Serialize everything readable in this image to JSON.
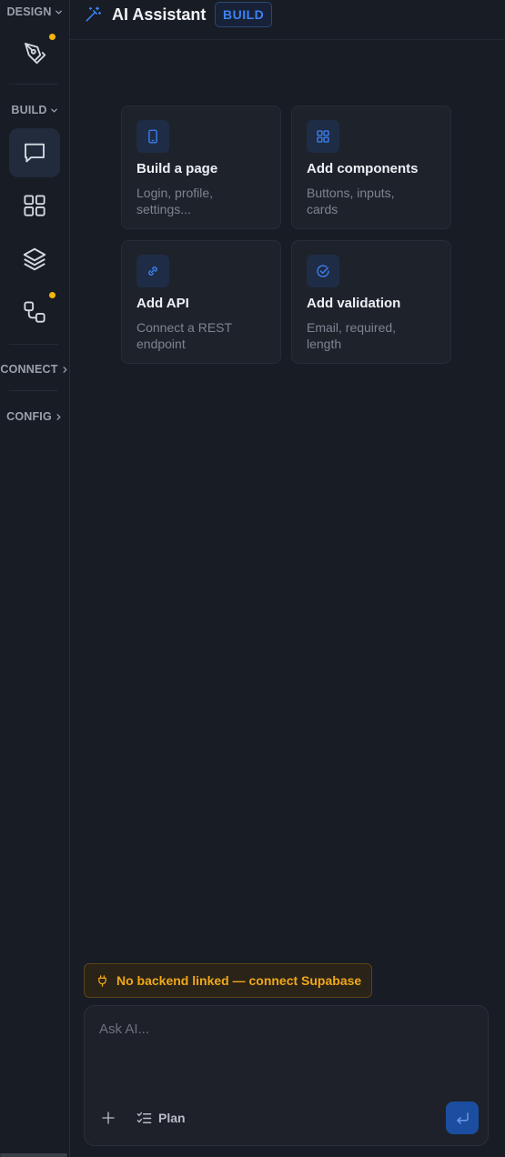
{
  "rail": {
    "design_label": "DESIGN",
    "build_label": "BUILD",
    "connect_label": "CONNECT",
    "config_label": "CONFIG",
    "items": [
      {
        "icon": "pen-tool-icon",
        "has_dot": true
      },
      {
        "icon": "chat-icon",
        "active": true
      },
      {
        "icon": "grid-icon"
      },
      {
        "icon": "layers-icon"
      },
      {
        "icon": "workflow-icon",
        "has_dot": true
      }
    ]
  },
  "header": {
    "icon": "magic-wand-icon",
    "title": "AI Assistant",
    "badge": "BUILD"
  },
  "cards": [
    {
      "icon": "phone-icon",
      "title": "Build a page",
      "desc": "Login, profile, settings..."
    },
    {
      "icon": "grid-icon",
      "title": "Add components",
      "desc": "Buttons, inputs, cards"
    },
    {
      "icon": "link-icon",
      "title": "Add API",
      "desc": "Connect a REST endpoint"
    },
    {
      "icon": "check-circle-icon",
      "title": "Add validation",
      "desc": "Email, required, length"
    }
  ],
  "notice": {
    "icon": "plug-icon",
    "text": "No backend linked — connect Supabase"
  },
  "composer": {
    "placeholder": "Ask AI...",
    "plan_label": "Plan"
  },
  "colors": {
    "accent": "#3d82f5",
    "warning": "#f0a818",
    "dot": "#f5b50a",
    "background": "#181c24"
  }
}
